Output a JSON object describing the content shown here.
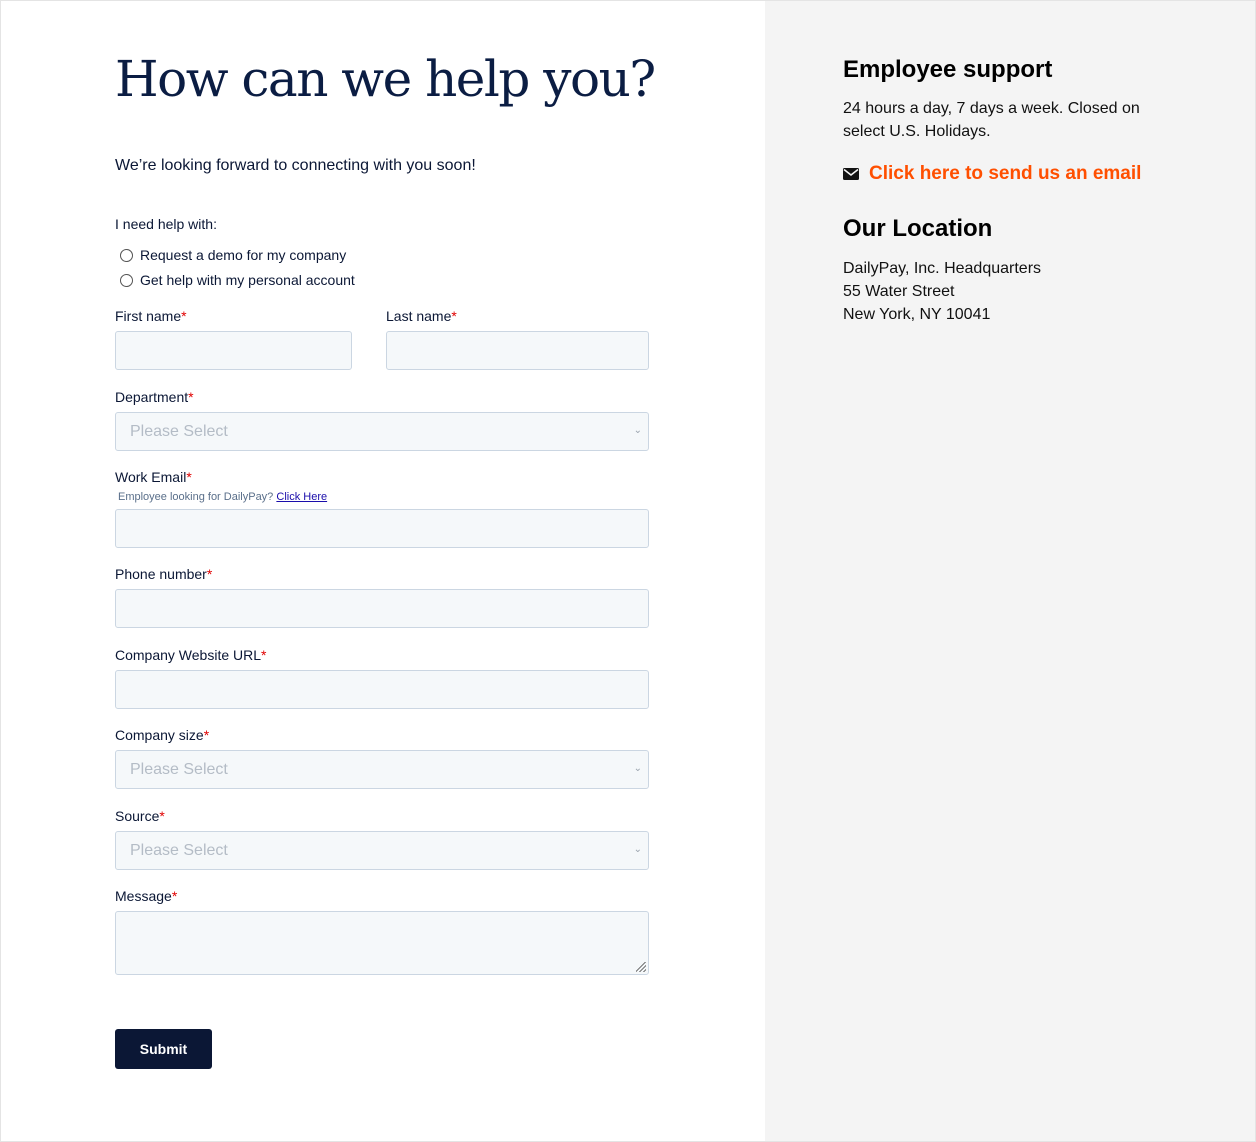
{
  "heading": "How can we help you?",
  "subtitle": "We’re looking forward to connecting with you soon!",
  "form": {
    "help_with_label": "I need help with:",
    "help_options": [
      "Request a demo for my company",
      "Get help with my personal account"
    ],
    "first_name_label": "First name",
    "last_name_label": "Last name",
    "department_label": "Department",
    "department_value": "Please Select",
    "work_email_label": "Work Email",
    "work_email_help": "Employee looking for DailyPay?",
    "work_email_help_link": "Click Here",
    "phone_label": "Phone number",
    "website_label": "Company Website URL",
    "company_size_label": "Company size",
    "company_size_value": "Please Select",
    "source_label": "Source",
    "source_value": "Please Select",
    "message_label": "Message",
    "required_marker": "*",
    "submit_label": "Submit"
  },
  "sidebar": {
    "support_heading": "Employee support",
    "support_hours_line1": "24 hours a day, 7 days a week. Closed on",
    "support_hours_line2": "select U.S. Holidays.",
    "email_link": "Click here to send us an email",
    "location_heading": "Our Location",
    "address_line1": "DailyPay, Inc. Headquarters",
    "address_line2": "55 Water Street",
    "address_line3": "New York, NY 10041"
  },
  "colors": {
    "navy": "#0b1735",
    "accent_orange": "#ff4f00",
    "required_red": "#e00000",
    "field_bg": "#f5f8fa",
    "sidebar_bg": "#f4f4f4"
  },
  "icons": {
    "email": "envelope-icon",
    "select": "chevron-down-icon",
    "textarea": "resize-grip-icon"
  }
}
